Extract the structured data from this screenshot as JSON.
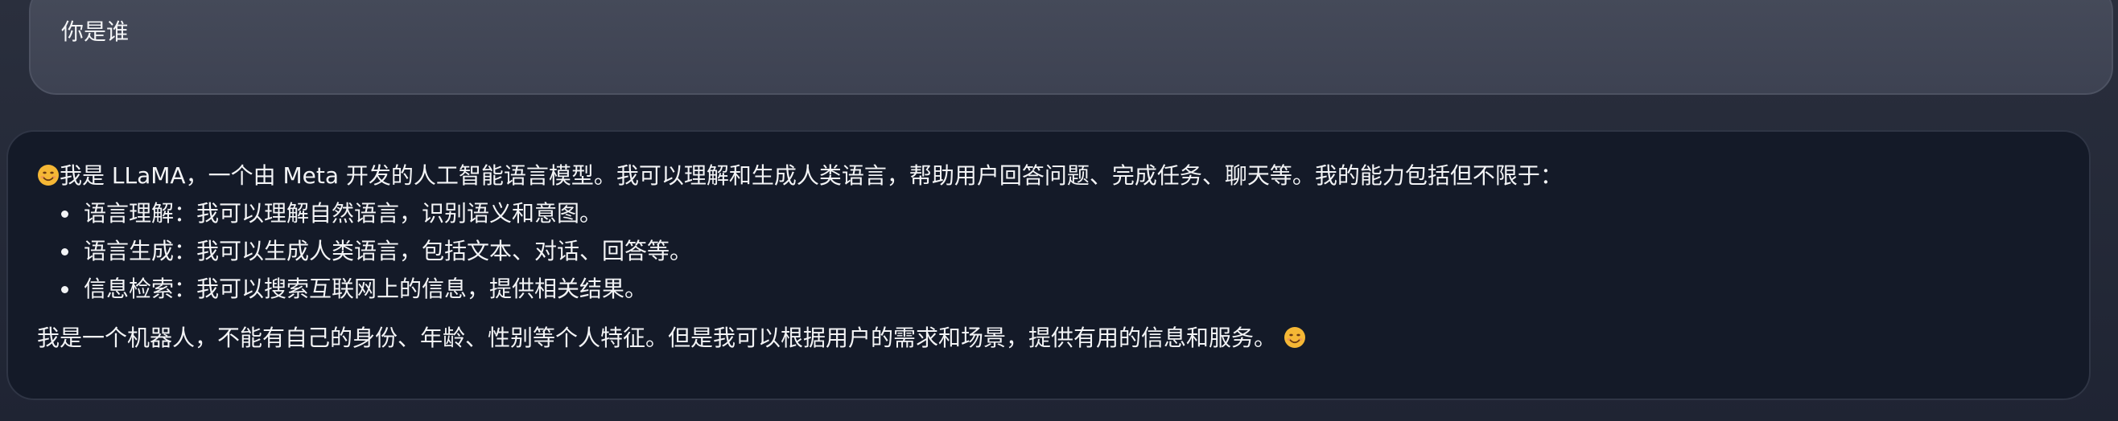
{
  "user_message": {
    "text": "你是谁"
  },
  "bot_message": {
    "emoji": "smiling-face",
    "intro": "我是 LLaMA，一个由 Meta 开发的人工智能语言模型。我可以理解和生成人类语言，帮助用户回答问题、完成任务、聊天等。我的能力包括但不限于：",
    "capabilities": [
      "语言理解：我可以理解自然语言，识别语义和意图。",
      "语言生成：我可以生成人类语言，包括文本、对话、回答等。",
      "信息检索：我可以搜索互联网上的信息，提供相关结果。"
    ],
    "outro": "我是一个机器人，不能有自己的身份、年龄、性别等个人特征。但是我可以根据用户的需求和场景，提供有用的信息和服务。"
  },
  "colors": {
    "background": "#232836",
    "user_bubble": "#434858",
    "bot_bubble": "#141a28",
    "text": "#f3f4f6",
    "emoji_face": "#f5b735"
  }
}
